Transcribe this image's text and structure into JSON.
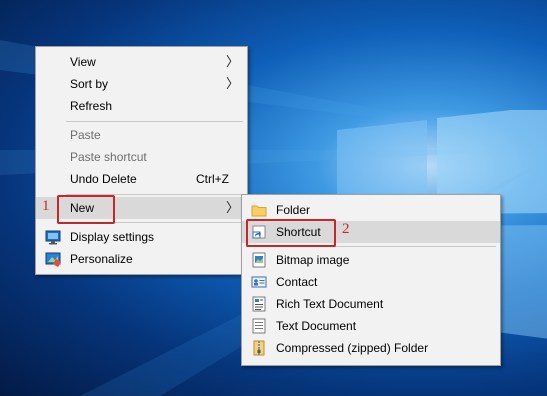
{
  "context_menu": {
    "items": [
      {
        "label": "View",
        "has_submenu": true,
        "enabled": true
      },
      {
        "label": "Sort by",
        "has_submenu": true,
        "enabled": true
      },
      {
        "label": "Refresh",
        "enabled": true
      },
      {
        "label": "Paste",
        "enabled": false
      },
      {
        "label": "Paste shortcut",
        "enabled": false
      },
      {
        "label": "Undo Delete",
        "shortcut": "Ctrl+Z",
        "enabled": true
      },
      {
        "label": "New",
        "has_submenu": true,
        "enabled": true,
        "highlighted": true
      },
      {
        "label": "Display settings",
        "icon": "display-settings-icon",
        "enabled": true
      },
      {
        "label": "Personalize",
        "icon": "personalize-icon",
        "enabled": true
      }
    ]
  },
  "new_submenu": {
    "items": [
      {
        "label": "Folder",
        "icon": "folder-icon"
      },
      {
        "label": "Shortcut",
        "icon": "shortcut-icon",
        "highlighted": true
      },
      {
        "label": "Bitmap image",
        "icon": "bitmap-icon"
      },
      {
        "label": "Contact",
        "icon": "contact-icon"
      },
      {
        "label": "Rich Text Document",
        "icon": "rich-text-icon"
      },
      {
        "label": "Text Document",
        "icon": "text-document-icon"
      },
      {
        "label": "Compressed (zipped) Folder",
        "icon": "zip-folder-icon"
      }
    ]
  },
  "annotations": {
    "step1": "1",
    "step2": "2",
    "color": "#c62828"
  },
  "arrow_glyph": "〉"
}
